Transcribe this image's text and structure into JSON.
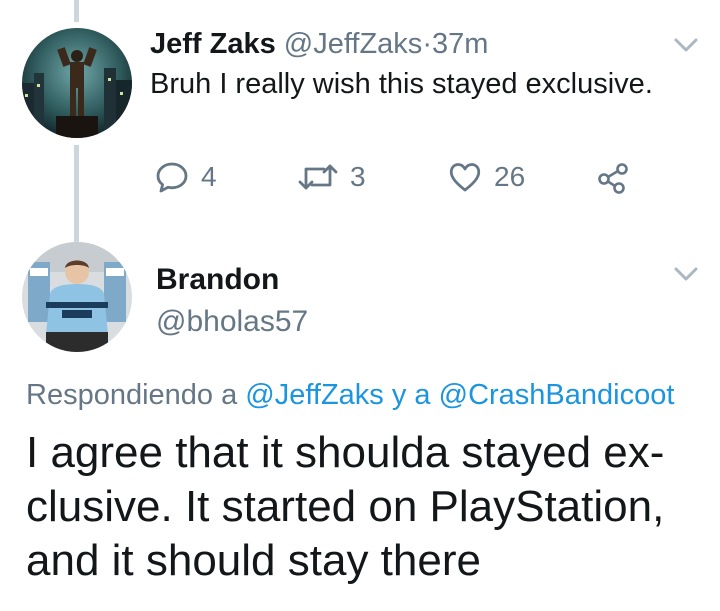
{
  "tweet1": {
    "name": "Jeff Zaks",
    "handle": "@JeffZaks",
    "separator": "·",
    "time": "37m",
    "text": "Bruh I really wish this stayed exclusive.",
    "actions": {
      "reply_count": "4",
      "retweet_count": "3",
      "like_count": "26"
    }
  },
  "tweet2": {
    "name": "Brandon",
    "handle": "@bholas57",
    "replying_prefix": "Respondiendo a",
    "replying_to_1": "@JeffZaks",
    "replying_conj": "y a",
    "replying_to_2": "@CrashBandicoot",
    "text_lines": [
      "I agree that it shoulda stayed ex-",
      "clusive. It started on PlayStation,",
      "and it should stay there"
    ]
  },
  "colors": {
    "secondary_text": "#657786",
    "link": "#1b95e0",
    "thread_line": "#ccd6dd"
  },
  "icons": [
    "chevron-down-icon",
    "reply-icon",
    "retweet-icon",
    "heart-icon",
    "share-icon"
  ]
}
